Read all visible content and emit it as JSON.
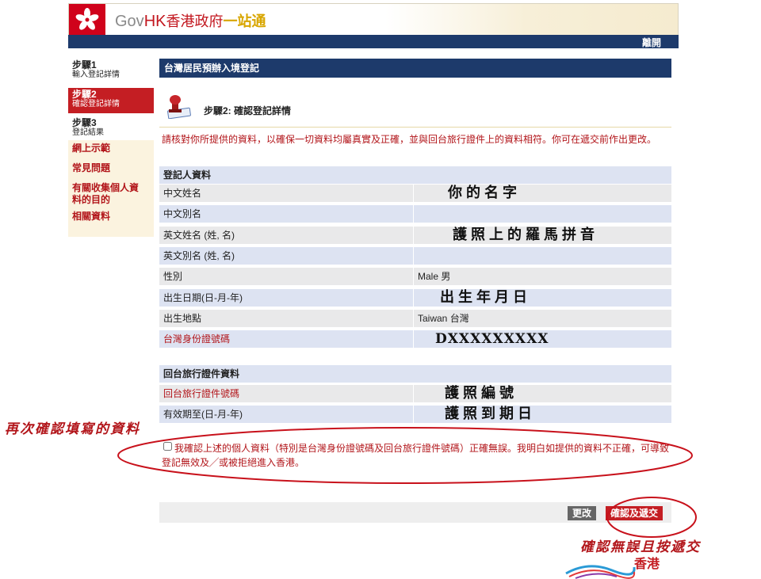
{
  "header": {
    "logo_gov": "Gov",
    "logo_hk": "HK",
    "logo_zh": "香港政府",
    "logo_yzt": "一站通",
    "logout": "離開"
  },
  "sidebar": {
    "steps": [
      {
        "title": "步驟1",
        "sub": "輸入登記詳情"
      },
      {
        "title": "步驟2",
        "sub": "確認登記詳情"
      },
      {
        "title": "步驟3",
        "sub": "登記結果"
      }
    ],
    "links": [
      "網上示範",
      "常見問題",
      "有關收集個人資料的目的",
      "相關資料"
    ]
  },
  "main": {
    "title": "台灣居民預辦入境登記",
    "step_heading": "步驟2: 確認登記詳情",
    "instruction": "請核對你所提供的資料，以確保一切資料均屬真實及正確，並與回台旅行證件上的資料相符。你可在遞交前作出更改。",
    "section1": {
      "title": "登記人資料",
      "rows": [
        {
          "label": "中文姓名",
          "value": "你的名字"
        },
        {
          "label": "中文別名",
          "value": ""
        },
        {
          "label": "英文姓名 (姓, 名)",
          "value": "護照上的羅馬拼音"
        },
        {
          "label": "英文別名 (姓, 名)",
          "value": ""
        },
        {
          "label": "性別",
          "value": "Male 男"
        },
        {
          "label": "出生日期(日-月-年)",
          "value": "出生年月日"
        },
        {
          "label": "出生地點",
          "value": "Taiwan 台灣"
        },
        {
          "label": "台灣身份證號碼",
          "value": "DXXXXXXXXX"
        }
      ]
    },
    "section2": {
      "title": "回台旅行證件資料",
      "rows": [
        {
          "label": "回台旅行證件號碼",
          "value": "護照編號"
        },
        {
          "label": "有效期至(日-月-年)",
          "value": "護照到期日"
        }
      ]
    },
    "declaration": "我確認上述的個人資料（特別是台灣身份證號碼及回台旅行證件號碼）正確無誤。我明白如提供的資料不正確，可導致登記無效及╱或被拒絕進入香港。",
    "declaration_checked": false,
    "buttons": {
      "edit": "更改",
      "submit": "確認及遞交"
    }
  },
  "annotations": {
    "confirm_note": "再次確認填寫的資料",
    "submit_note": "確認無誤且按遞交",
    "brand": "香港"
  },
  "colors": {
    "navy": "#1d3a6b",
    "red": "#b2151a",
    "brand_red": "#d0021b"
  }
}
